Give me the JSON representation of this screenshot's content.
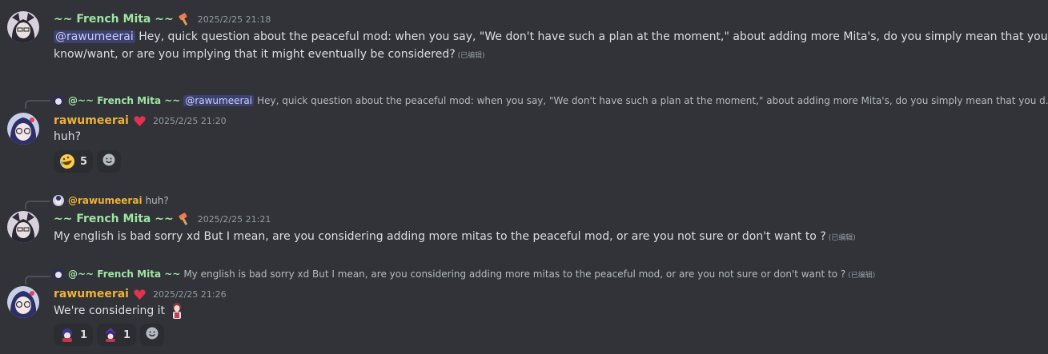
{
  "messages": [
    {
      "author": "~~ French Mita ~~",
      "timestamp": "2025/2/25 21:18",
      "mention": "@rawumeerai",
      "line1": "Hey, quick question about the peaceful mod: when you say, \"We don't have such a plan at the moment,\" about adding more Mita's, do you simply mean that you don't",
      "line2": "know/want, or are you implying that it might eventually be considered?",
      "edited": "(已编辑)"
    },
    {
      "reply_author": "@~~ French Mita ~~",
      "reply_mention": "@rawumeerai",
      "reply_text": "Hey, quick question about the peaceful mod: when you say, \"We don't have such a plan at the moment,\" about adding more Mita's, do you simply mean that you don't kn...",
      "author": "rawumeerai",
      "timestamp": "2025/2/25 21:20",
      "text": "huh?",
      "reactions": [
        {
          "emoji": "rofl-emoji",
          "count": "5"
        }
      ]
    },
    {
      "reply_author": "@rawumeerai",
      "reply_text": "huh?",
      "author": "~~ French Mita ~~",
      "timestamp": "2025/2/25 21:21",
      "text": "My english is bad sorry xd But I mean, are you considering adding more mitas to the peaceful mod, or are you not sure or don't want to ?",
      "edited": "(已编辑)"
    },
    {
      "reply_author": "@~~ French Mita ~~",
      "reply_text": "My english is bad sorry xd But I mean, are you considering adding more mitas to the peaceful mod, or are you not sure or don't want to ?",
      "reply_edited": "(已编辑)",
      "author": "rawumeerai",
      "timestamp": "2025/2/25 21:26",
      "text": "We're considering it",
      "reactions": [
        {
          "emoji": "mita-custom-emoji-1",
          "count": "1"
        },
        {
          "emoji": "mita-custom-emoji-2",
          "count": "1"
        }
      ]
    }
  ],
  "colors": {
    "background": "#313338",
    "mita_name": "#9fe3a3",
    "rawu_name": "#f0b232",
    "mention_bg": "#3c4270",
    "reaction_bg": "#2b2d31"
  }
}
